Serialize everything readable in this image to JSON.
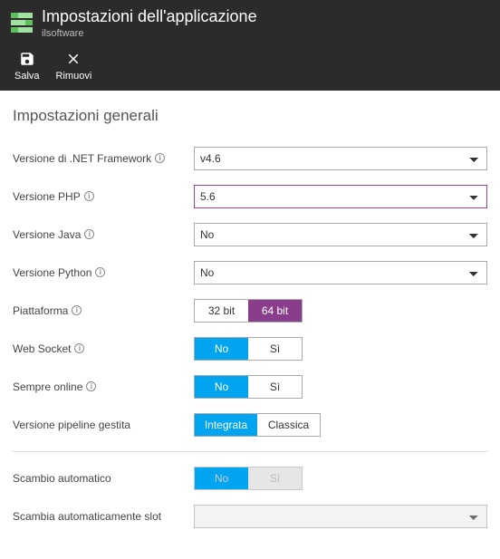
{
  "header": {
    "title": "Impostazioni dell'applicazione",
    "subtitle": "ilsoftware",
    "toolbar": {
      "save": "Salva",
      "remove": "Rimuovi"
    }
  },
  "section_title": "Impostazioni generali",
  "rows": {
    "dotnet": {
      "label": "Versione di .NET Framework",
      "value": "v4.6"
    },
    "php": {
      "label": "Versione PHP",
      "value": "5.6"
    },
    "java": {
      "label": "Versione Java",
      "value": "No"
    },
    "python": {
      "label": "Versione Python",
      "value": "No"
    },
    "platform": {
      "label": "Piattaforma",
      "opt1": "32 bit",
      "opt2": "64 bit",
      "active": "64 bit"
    },
    "websocket": {
      "label": "Web Socket",
      "opt1": "No",
      "opt2": "Sì",
      "active": "No"
    },
    "alwayson": {
      "label": "Sempre online",
      "opt1": "No",
      "opt2": "Sì",
      "active": "No"
    },
    "pipeline": {
      "label": "Versione pipeline gestita",
      "opt1": "Integrata",
      "opt2": "Classica",
      "active": "Integrata"
    },
    "autoswap": {
      "label": "Scambio automatico",
      "opt1": "No",
      "opt2": "Sì",
      "active": "No"
    },
    "autoswap_slot": {
      "label": "Scambia automaticamente slot",
      "value": ""
    }
  }
}
